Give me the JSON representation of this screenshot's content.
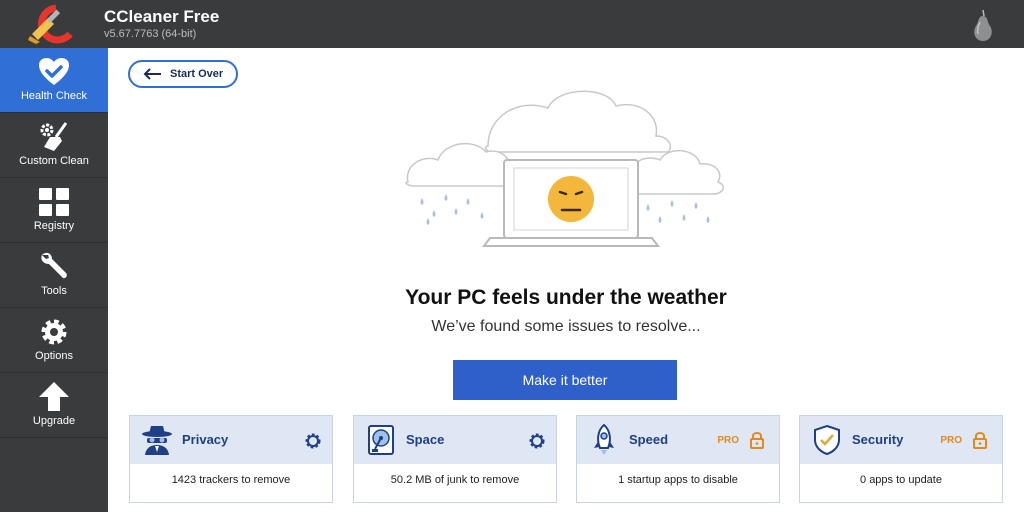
{
  "app": {
    "title": "CCleaner Free",
    "version": "v5.67.7763 (64-bit)",
    "accent_color": "#2f6fd6",
    "cta_color": "#2f5fc9",
    "sidebar_color": "#3a3b3d"
  },
  "sidebar": {
    "items": [
      {
        "label": "Health Check",
        "icon": "heart-check-icon",
        "active": true
      },
      {
        "label": "Custom Clean",
        "icon": "broom-gear-icon",
        "active": false
      },
      {
        "label": "Registry",
        "icon": "grid-icon",
        "active": false
      },
      {
        "label": "Tools",
        "icon": "wrench-icon",
        "active": false
      },
      {
        "label": "Options",
        "icon": "gear-icon",
        "active": false
      },
      {
        "label": "Upgrade",
        "icon": "up-arrow-icon",
        "active": false
      }
    ]
  },
  "main": {
    "start_over": "Start Over",
    "headline": "Your PC feels under the weather",
    "subline": "We’ve found some issues to resolve...",
    "cta": "Make it better"
  },
  "cards": [
    {
      "title": "Privacy",
      "icon": "spy-icon",
      "action_icon": "gear-icon",
      "pro": false,
      "detail": "1423 trackers to remove"
    },
    {
      "title": "Space",
      "icon": "disk-icon",
      "action_icon": "gear-icon",
      "pro": false,
      "detail": "50.2 MB of junk to remove"
    },
    {
      "title": "Speed",
      "icon": "rocket-icon",
      "action_icon": "lock-icon",
      "pro": true,
      "pro_label": "PRO",
      "detail": "1 startup apps to disable"
    },
    {
      "title": "Security",
      "icon": "shield-check-icon",
      "action_icon": "lock-icon",
      "pro": true,
      "pro_label": "PRO",
      "detail": "0 apps to update"
    }
  ]
}
